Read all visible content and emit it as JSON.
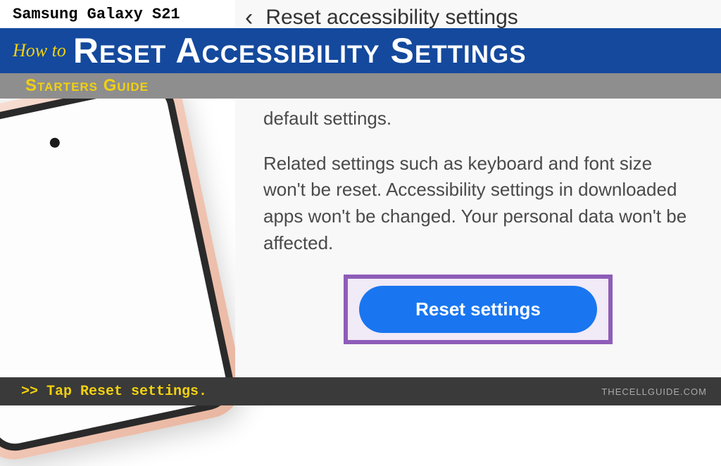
{
  "header": {
    "device_label": "Samsung Galaxy S21",
    "howto_prefix": "How to",
    "title": "Reset Accessibility Settings",
    "subtitle": "Starters Guide"
  },
  "panel": {
    "title": "Reset accessibility settings",
    "paragraph1": "default settings.",
    "paragraph2": "Related settings such as keyboard and font size won't be reset. Accessibility settings in downloaded apps won't be changed. Your personal data won't be affected.",
    "button_label": "Reset settings"
  },
  "footer": {
    "instruction": ">> Tap Reset settings.",
    "watermark": "THECELLGUIDE.COM"
  }
}
